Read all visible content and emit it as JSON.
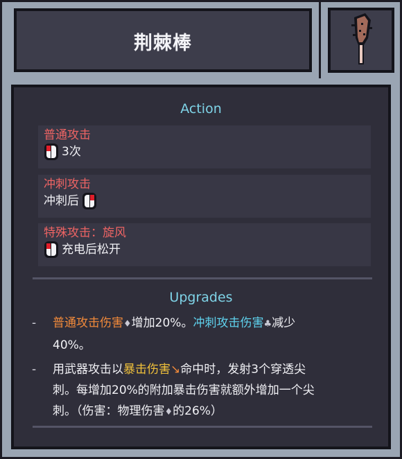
{
  "item": {
    "name": "荆棘棒"
  },
  "action": {
    "heading": "Action",
    "entries": [
      {
        "title": "普通攻击",
        "detail": "3次"
      },
      {
        "title": "冲刺攻击",
        "detail": "冲刺后"
      },
      {
        "title": "特殊攻击：旋风",
        "detail": "充电后松开"
      }
    ]
  },
  "upgrades": {
    "heading": "Upgrades",
    "item1": {
      "dash": "-",
      "term1": "普通攻击伤害",
      "glyph1": "♦",
      "text1": "增加20%。",
      "term2": "冲刺攻击伤害",
      "glyph2": "♣",
      "text2": "减少",
      "text3": "40%。"
    },
    "item2": {
      "dash": "-",
      "text1": "用武器攻击以",
      "term1": "暴击伤害",
      "glyph1": "↘",
      "text2": "命中时，发射3个穿透尖",
      "text3": "刺。每增加20%的附加暴击伤害就额外增加一个尖",
      "text4": "刺。（伤害：物理伤害",
      "glyph2": "♦",
      "text5": "的26%）"
    }
  },
  "colors": {
    "frame": "#9aa5b3",
    "panel": "#2f2e3a",
    "action_title": "#ee6464",
    "heading": "#7fd4e8",
    "orange": "#f28a3a",
    "cyan": "#5fd2ee",
    "yellow": "#f2c23a"
  }
}
